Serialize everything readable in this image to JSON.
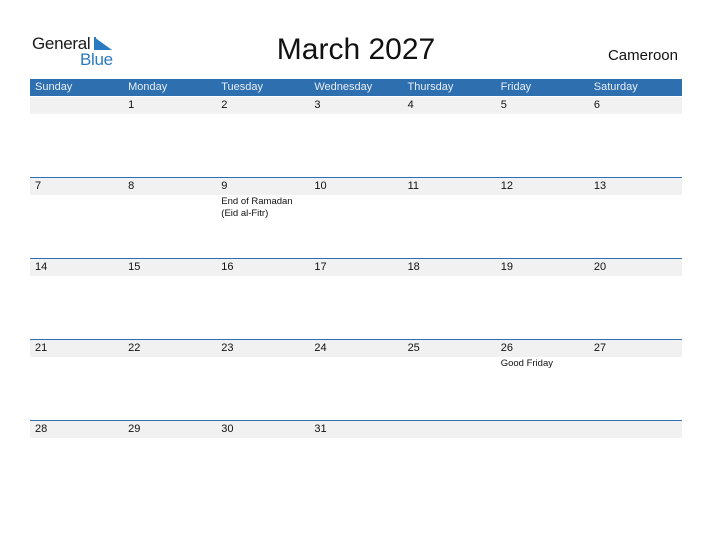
{
  "logo": {
    "line1": "General",
    "line2": "Blue"
  },
  "title": "March 2027",
  "country": "Cameroon",
  "colors": {
    "header_bg": "#2e6fb0",
    "strip_bg": "#f1f1f1",
    "brand_blue": "#2a7ac3"
  },
  "weekdays": [
    "Sunday",
    "Monday",
    "Tuesday",
    "Wednesday",
    "Thursday",
    "Friday",
    "Saturday"
  ],
  "weeks": [
    [
      {
        "day": ""
      },
      {
        "day": "1"
      },
      {
        "day": "2"
      },
      {
        "day": "3"
      },
      {
        "day": "4"
      },
      {
        "day": "5"
      },
      {
        "day": "6"
      }
    ],
    [
      {
        "day": "7"
      },
      {
        "day": "8"
      },
      {
        "day": "9",
        "event": "End of Ramadan (Eid al-Fitr)"
      },
      {
        "day": "10"
      },
      {
        "day": "11"
      },
      {
        "day": "12"
      },
      {
        "day": "13"
      }
    ],
    [
      {
        "day": "14"
      },
      {
        "day": "15"
      },
      {
        "day": "16"
      },
      {
        "day": "17"
      },
      {
        "day": "18"
      },
      {
        "day": "19"
      },
      {
        "day": "20"
      }
    ],
    [
      {
        "day": "21"
      },
      {
        "day": "22"
      },
      {
        "day": "23"
      },
      {
        "day": "24"
      },
      {
        "day": "25"
      },
      {
        "day": "26",
        "event": "Good Friday"
      },
      {
        "day": "27"
      }
    ],
    [
      {
        "day": "28"
      },
      {
        "day": "29"
      },
      {
        "day": "30"
      },
      {
        "day": "31"
      },
      {
        "day": ""
      },
      {
        "day": ""
      },
      {
        "day": ""
      }
    ]
  ]
}
